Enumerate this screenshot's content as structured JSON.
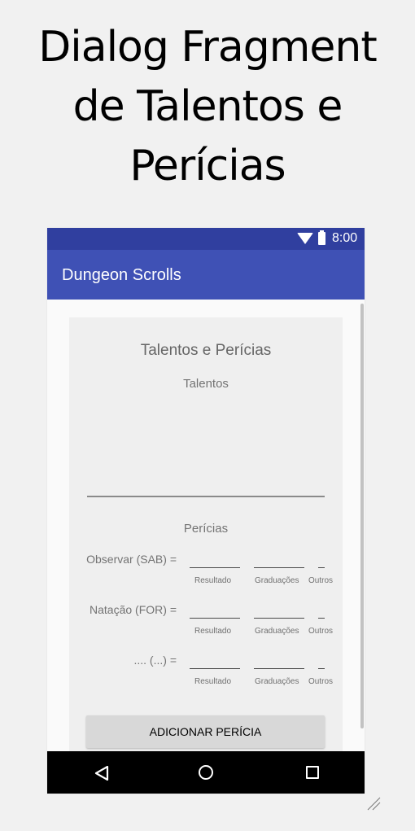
{
  "headline": {
    "line1": "Dialog Fragment",
    "line2": "de Talentos e",
    "line3": "Perícias"
  },
  "status_bar": {
    "time": "8:00",
    "icons": [
      "wifi-icon",
      "battery-icon"
    ]
  },
  "app_bar": {
    "title": "Dungeon Scrolls"
  },
  "dialog": {
    "title": "Talentos e Perícias",
    "talentos_heading": "Talentos",
    "pericias_heading": "Perícias",
    "rows": [
      {
        "label": "Observar (SAB) =",
        "resultado": "Resultado",
        "graduacoes": "Graduações",
        "outros": "Outros"
      },
      {
        "label": "Natação (FOR) =",
        "resultado": "Resultado",
        "graduacoes": "Graduações",
        "outros": "Outros"
      },
      {
        "label": ".... (...) =",
        "resultado": "Resultado",
        "graduacoes": "Graduações",
        "outros": "Outros"
      }
    ],
    "add_button": "ADICIONAR PERÍCIA"
  },
  "nav_bar": {
    "icons": [
      "back-icon",
      "home-icon",
      "recent-apps-icon"
    ]
  },
  "colors": {
    "status_bar": "#303f9f",
    "app_bar": "#3f51b5",
    "nav_bar": "#000000"
  }
}
